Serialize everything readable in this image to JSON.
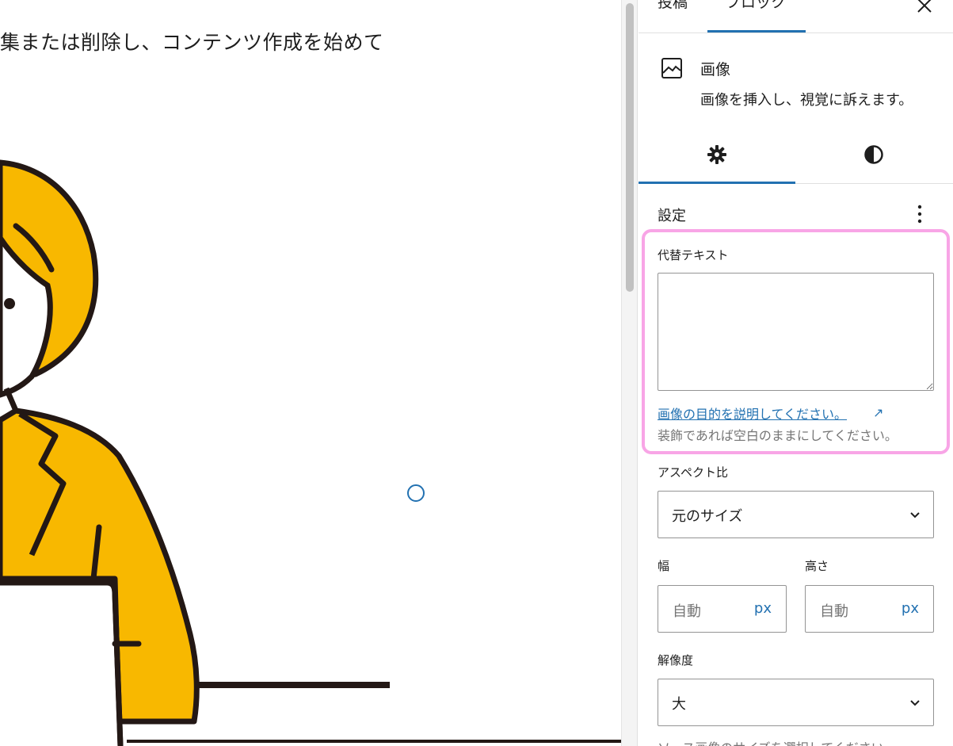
{
  "canvas": {
    "paragraph_text": "集または削除し、コンテンツ作成を始めて"
  },
  "sidebar": {
    "tabs": [
      {
        "label": "投稿"
      },
      {
        "label": "ブロック"
      }
    ],
    "active_tab": "ブロック",
    "block": {
      "icon": "image-icon",
      "title": "画像",
      "description": "画像を挿入し、視覚に訴えます。"
    },
    "panel_tabs": [
      {
        "icon": "gear-icon"
      },
      {
        "icon": "contrast-icon"
      }
    ],
    "settings": {
      "heading": "設定",
      "alt_text": {
        "label": "代替テキスト",
        "value": "",
        "help_link": "画像の目的を説明してください。",
        "help_text": "装飾であれば空白のままにしてください。"
      },
      "aspect_ratio": {
        "label": "アスペクト比",
        "selected": "元のサイズ"
      },
      "width": {
        "label": "幅",
        "placeholder": "自動",
        "unit": "px"
      },
      "height": {
        "label": "高さ",
        "placeholder": "自動",
        "unit": "px"
      },
      "resolution": {
        "label": "解像度",
        "selected": "大",
        "help_text": "ソース画像のサイズを選択してください。"
      }
    }
  },
  "colors": {
    "accent": "#2271b1",
    "highlight": "#f8a5e6",
    "illustration_yellow": "#f8b800",
    "outline": "#231815"
  }
}
